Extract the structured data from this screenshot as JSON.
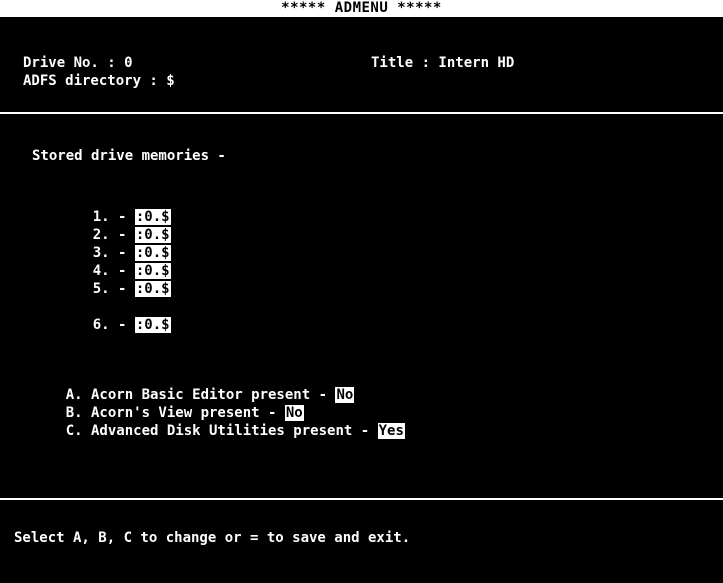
{
  "header": {
    "title": "*****  ADMENU  *****"
  },
  "info": {
    "drive_label": "Drive No. : 0",
    "directory_label": "ADFS directory : $",
    "title_label": "Title : Intern HD"
  },
  "memories": {
    "heading": "Stored drive memories -",
    "items": [
      {
        "index": "1. - ",
        "value": ":0.$"
      },
      {
        "index": "2. - ",
        "value": ":0.$"
      },
      {
        "index": "3. - ",
        "value": ":0.$"
      },
      {
        "index": "4. - ",
        "value": ":0.$"
      },
      {
        "index": "5. - ",
        "value": ":0.$"
      },
      {
        "index": "6. - ",
        "value": ":0.$"
      }
    ]
  },
  "options": [
    {
      "label": "A. Acorn Basic Editor present - ",
      "value": "No"
    },
    {
      "label": "B. Acorn's View present - ",
      "value": "No"
    },
    {
      "label": "C. Advanced Disk Utilities present - ",
      "value": "Yes"
    }
  ],
  "footer": {
    "prompt": "Select A, B, C to change or = to save and exit."
  }
}
